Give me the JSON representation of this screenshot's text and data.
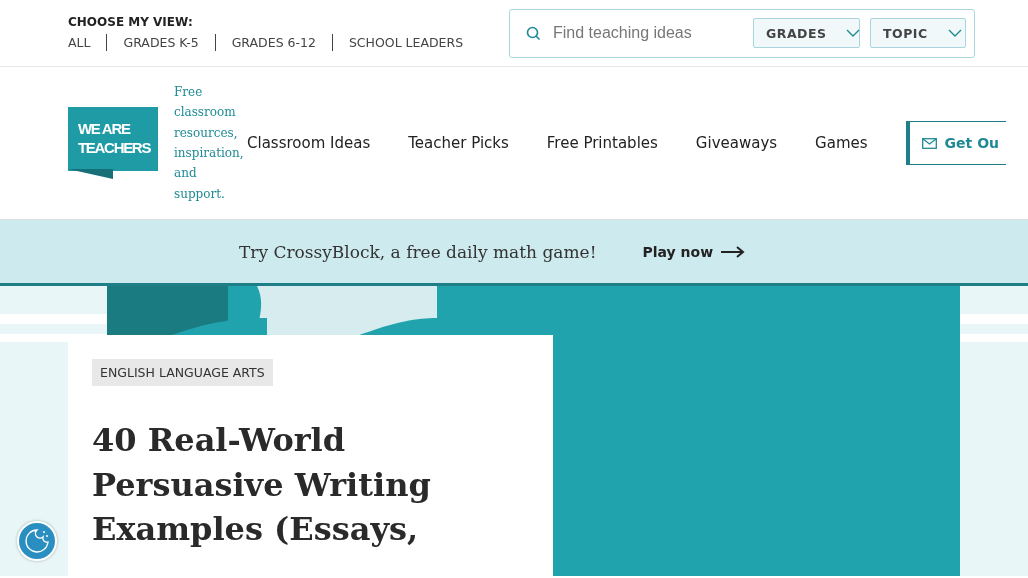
{
  "view_chooser": {
    "label": "CHOOSE MY VIEW:",
    "options": [
      "ALL",
      "GRADES K-5",
      "GRADES 6-12",
      "SCHOOL LEADERS"
    ]
  },
  "search": {
    "placeholder": "Find teaching ideas",
    "filters": [
      "GRADES",
      "TOPIC"
    ]
  },
  "logo": {
    "text": "WE ARE TEACHERS",
    "tagline": "Free classroom resources, inspiration, and support."
  },
  "nav": {
    "items": [
      "Classroom Ideas",
      "Teacher Picks",
      "Free Printables",
      "Giveaways",
      "Games"
    ],
    "cta": "Get Ou"
  },
  "banner": {
    "text": "Try CrossyBlock, a free daily math game!",
    "link": "Play now"
  },
  "article": {
    "category": "ENGLISH LANGUAGE ARTS",
    "title": "40 Real-World Persuasive Writing Examples (Essays,"
  }
}
